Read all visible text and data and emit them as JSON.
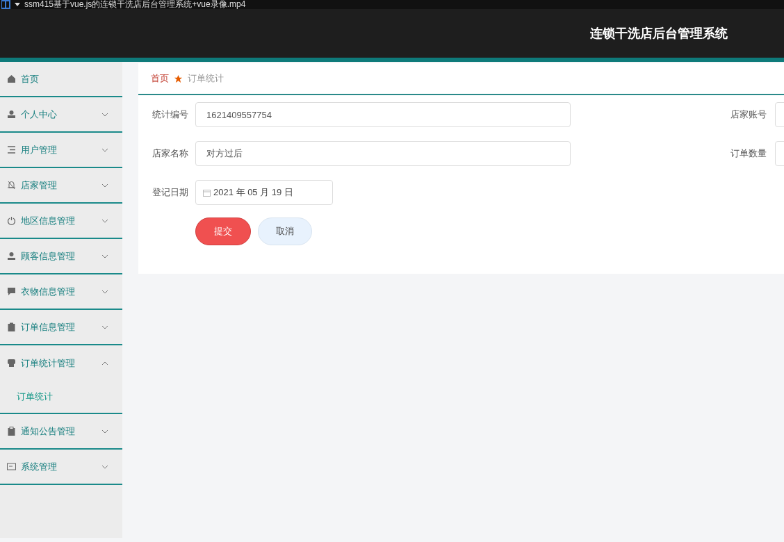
{
  "video_bar": {
    "title": "ssm415基于vue.js的连锁干洗店后台管理系统+vue录像.mp4"
  },
  "header": {
    "title": "连锁干洗店后台管理系统"
  },
  "sidebar": {
    "items": [
      {
        "label": "首页"
      },
      {
        "label": "个人中心",
        "expanded": false
      },
      {
        "label": "用户管理",
        "expanded": false
      },
      {
        "label": "店家管理",
        "expanded": false
      },
      {
        "label": "地区信息管理",
        "expanded": false
      },
      {
        "label": "顾客信息管理",
        "expanded": false
      },
      {
        "label": "衣物信息管理",
        "expanded": false
      },
      {
        "label": "订单信息管理",
        "expanded": false
      },
      {
        "label": "订单统计管理",
        "expanded": true,
        "children": [
          {
            "label": "订单统计"
          }
        ]
      },
      {
        "label": "通知公告管理",
        "expanded": false
      },
      {
        "label": "系统管理",
        "expanded": false
      }
    ]
  },
  "breadcrumb": [
    "首页",
    "订单统计"
  ],
  "form": {
    "rows": [
      {
        "left": {
          "label": "统计编号",
          "value": "1621409557754",
          "kind": "text"
        },
        "right": {
          "label": "店家账号"
        }
      },
      {
        "left": {
          "label": "店家名称",
          "value": "对方过后",
          "kind": "text"
        },
        "right": {
          "label": "订单数量"
        }
      },
      {
        "left": {
          "label": "登记日期",
          "value": "2021 年 05 月 19 日",
          "kind": "date"
        }
      }
    ],
    "buttons": [
      {
        "label": "提交",
        "kind": "primary"
      },
      {
        "label": "取消",
        "kind": "secondary"
      }
    ]
  }
}
